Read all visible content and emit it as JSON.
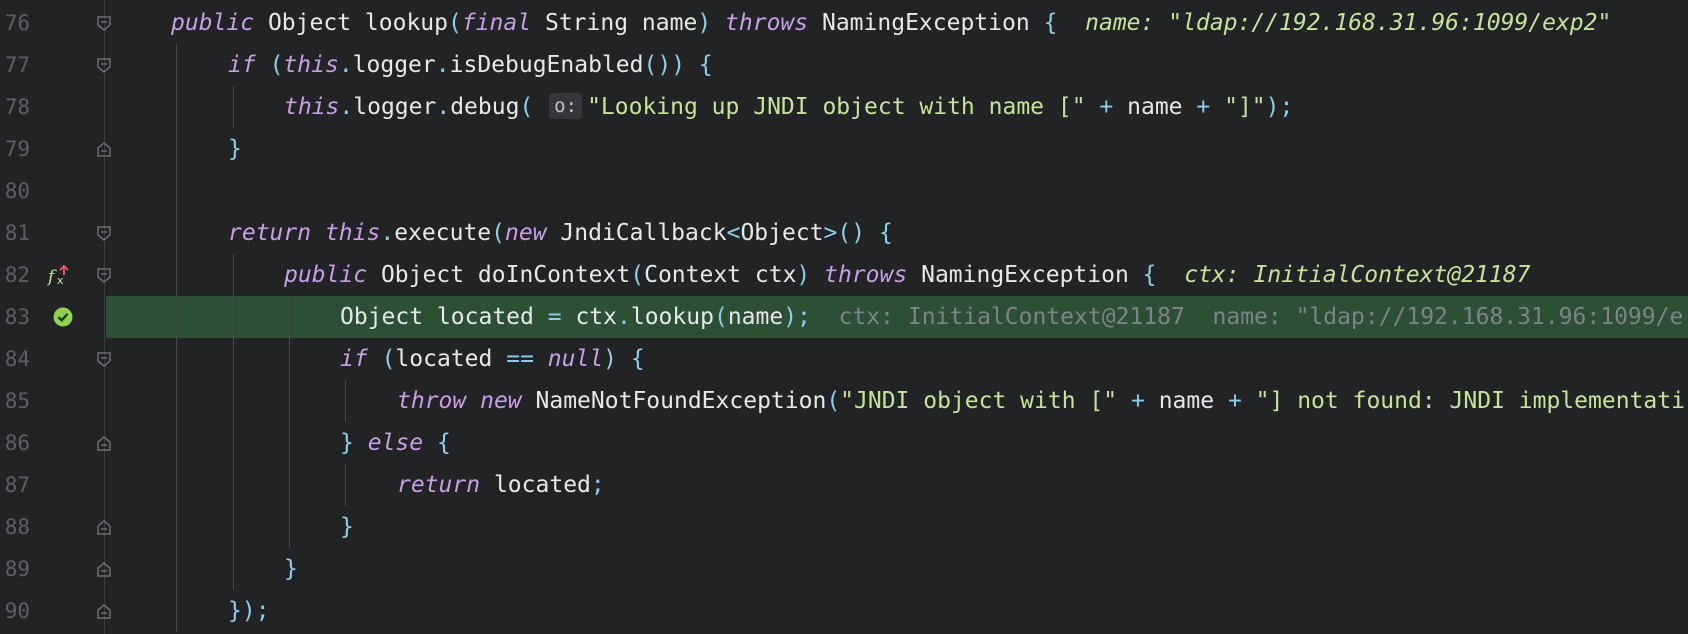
{
  "colors": {
    "background": "#222325",
    "exec_line": "#2d5035",
    "keyword": "#c99ee6",
    "string": "#c4e49a",
    "punct": "#89d0f0",
    "ident": "#e6e8ea",
    "hint": "#7f8287",
    "line_number": "#5c6066"
  },
  "icons": {
    "fx_marker": "function-return-icon",
    "check_marker": "execution-point-check-icon",
    "fold_open": "fold-open-icon",
    "fold_close": "fold-close-icon"
  },
  "lines": [
    {
      "num": "76",
      "t": {
        "a": "public",
        "b": "Object",
        "c": "lookup",
        "d": "(",
        "e": "final",
        "f": "String",
        "g": "name",
        "h": ")",
        "i": "throws",
        "j": "NamingException",
        "k": "{",
        "hn": "name:",
        "hv": "\"ldap://192.168.31.96:1099/exp2\""
      }
    },
    {
      "num": "77",
      "t": {
        "a": "if",
        "b": "(",
        "c": "this",
        ".1": ".",
        "d": "logger",
        "e": ".",
        "f": "isDebugEnabled",
        "g": "())",
        "h": "{"
      }
    },
    {
      "num": "78",
      "t": {
        "a": "this",
        "b": ".",
        "c": "logger",
        "d": ".",
        "e": "debug",
        "f": "(",
        "ph": "o:",
        "g": "\"Looking up JNDI object with name [\"",
        "h": "+",
        "i": "name",
        "j": "+",
        "k": "\"]\"",
        "l": ");"
      }
    },
    {
      "num": "79",
      "t": {
        "a": "}"
      }
    },
    {
      "num": "80",
      "t": {}
    },
    {
      "num": "81",
      "t": {
        "a": "return",
        "b": "this",
        "c": ".",
        "d": "execute",
        "e": "(",
        "f": "new",
        "g": "JndiCallback",
        "h": "<",
        "i": "Object",
        "j": ">()",
        "k": "{"
      }
    },
    {
      "num": "82",
      "t": {
        "a": "public",
        "b": "Object",
        "c": "doInContext",
        "d": "(",
        "e": "Context ctx",
        "f": ")",
        "g": "throws",
        "h": "NamingException",
        "i": "{",
        "hn": "ctx:",
        "hv": "InitialContext@21187"
      }
    },
    {
      "num": "83",
      "t": {
        "a": "Object located",
        "b": "=",
        "c": "ctx",
        "d": ".",
        "e": "lookup",
        "f": "(",
        "g": "name",
        "h": ");",
        "h1": "ctx: InitialContext@21187",
        "h2": "name: \"ldap://192.168.31.96:1099/e"
      }
    },
    {
      "num": "84",
      "t": {
        "a": "if",
        "b": "(",
        "c": "located",
        "d": "==",
        "e": "null",
        "f": ")",
        "g": "{"
      }
    },
    {
      "num": "85",
      "t": {
        "a": "throw",
        "b": "new",
        "c": "NameNotFoundException",
        "d": "(",
        "e": "\"JNDI object with [\"",
        "f": "+",
        "g": "name",
        "h": "+",
        "i": "\"] not found: JNDI implementati"
      }
    },
    {
      "num": "86",
      "t": {
        "a": "}",
        "b": "else",
        "c": "{"
      }
    },
    {
      "num": "87",
      "t": {
        "a": "return",
        "b": "located",
        "c": ";"
      }
    },
    {
      "num": "88",
      "t": {
        "a": "}"
      }
    },
    {
      "num": "89",
      "t": {
        "a": "}"
      }
    },
    {
      "num": "90",
      "t": {
        "a": "});"
      }
    }
  ]
}
